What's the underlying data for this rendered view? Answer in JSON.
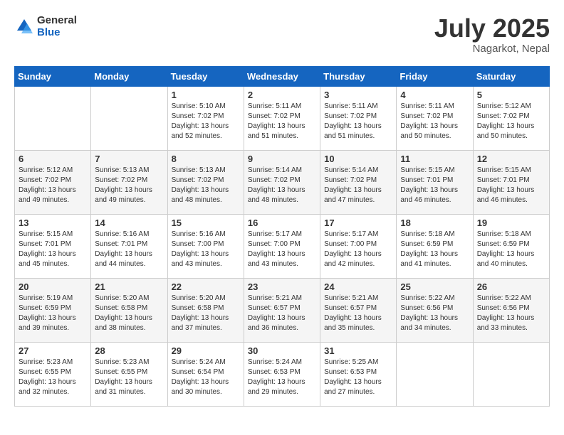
{
  "header": {
    "logo_general": "General",
    "logo_blue": "Blue",
    "month_year": "July 2025",
    "location": "Nagarkot, Nepal"
  },
  "days_of_week": [
    "Sunday",
    "Monday",
    "Tuesday",
    "Wednesday",
    "Thursday",
    "Friday",
    "Saturday"
  ],
  "weeks": [
    [
      {
        "day": "",
        "info": ""
      },
      {
        "day": "",
        "info": ""
      },
      {
        "day": "1",
        "info": "Sunrise: 5:10 AM\nSunset: 7:02 PM\nDaylight: 13 hours and 52 minutes."
      },
      {
        "day": "2",
        "info": "Sunrise: 5:11 AM\nSunset: 7:02 PM\nDaylight: 13 hours and 51 minutes."
      },
      {
        "day": "3",
        "info": "Sunrise: 5:11 AM\nSunset: 7:02 PM\nDaylight: 13 hours and 51 minutes."
      },
      {
        "day": "4",
        "info": "Sunrise: 5:11 AM\nSunset: 7:02 PM\nDaylight: 13 hours and 50 minutes."
      },
      {
        "day": "5",
        "info": "Sunrise: 5:12 AM\nSunset: 7:02 PM\nDaylight: 13 hours and 50 minutes."
      }
    ],
    [
      {
        "day": "6",
        "info": "Sunrise: 5:12 AM\nSunset: 7:02 PM\nDaylight: 13 hours and 49 minutes."
      },
      {
        "day": "7",
        "info": "Sunrise: 5:13 AM\nSunset: 7:02 PM\nDaylight: 13 hours and 49 minutes."
      },
      {
        "day": "8",
        "info": "Sunrise: 5:13 AM\nSunset: 7:02 PM\nDaylight: 13 hours and 48 minutes."
      },
      {
        "day": "9",
        "info": "Sunrise: 5:14 AM\nSunset: 7:02 PM\nDaylight: 13 hours and 48 minutes."
      },
      {
        "day": "10",
        "info": "Sunrise: 5:14 AM\nSunset: 7:02 PM\nDaylight: 13 hours and 47 minutes."
      },
      {
        "day": "11",
        "info": "Sunrise: 5:15 AM\nSunset: 7:01 PM\nDaylight: 13 hours and 46 minutes."
      },
      {
        "day": "12",
        "info": "Sunrise: 5:15 AM\nSunset: 7:01 PM\nDaylight: 13 hours and 46 minutes."
      }
    ],
    [
      {
        "day": "13",
        "info": "Sunrise: 5:15 AM\nSunset: 7:01 PM\nDaylight: 13 hours and 45 minutes."
      },
      {
        "day": "14",
        "info": "Sunrise: 5:16 AM\nSunset: 7:01 PM\nDaylight: 13 hours and 44 minutes."
      },
      {
        "day": "15",
        "info": "Sunrise: 5:16 AM\nSunset: 7:00 PM\nDaylight: 13 hours and 43 minutes."
      },
      {
        "day": "16",
        "info": "Sunrise: 5:17 AM\nSunset: 7:00 PM\nDaylight: 13 hours and 43 minutes."
      },
      {
        "day": "17",
        "info": "Sunrise: 5:17 AM\nSunset: 7:00 PM\nDaylight: 13 hours and 42 minutes."
      },
      {
        "day": "18",
        "info": "Sunrise: 5:18 AM\nSunset: 6:59 PM\nDaylight: 13 hours and 41 minutes."
      },
      {
        "day": "19",
        "info": "Sunrise: 5:18 AM\nSunset: 6:59 PM\nDaylight: 13 hours and 40 minutes."
      }
    ],
    [
      {
        "day": "20",
        "info": "Sunrise: 5:19 AM\nSunset: 6:59 PM\nDaylight: 13 hours and 39 minutes."
      },
      {
        "day": "21",
        "info": "Sunrise: 5:20 AM\nSunset: 6:58 PM\nDaylight: 13 hours and 38 minutes."
      },
      {
        "day": "22",
        "info": "Sunrise: 5:20 AM\nSunset: 6:58 PM\nDaylight: 13 hours and 37 minutes."
      },
      {
        "day": "23",
        "info": "Sunrise: 5:21 AM\nSunset: 6:57 PM\nDaylight: 13 hours and 36 minutes."
      },
      {
        "day": "24",
        "info": "Sunrise: 5:21 AM\nSunset: 6:57 PM\nDaylight: 13 hours and 35 minutes."
      },
      {
        "day": "25",
        "info": "Sunrise: 5:22 AM\nSunset: 6:56 PM\nDaylight: 13 hours and 34 minutes."
      },
      {
        "day": "26",
        "info": "Sunrise: 5:22 AM\nSunset: 6:56 PM\nDaylight: 13 hours and 33 minutes."
      }
    ],
    [
      {
        "day": "27",
        "info": "Sunrise: 5:23 AM\nSunset: 6:55 PM\nDaylight: 13 hours and 32 minutes."
      },
      {
        "day": "28",
        "info": "Sunrise: 5:23 AM\nSunset: 6:55 PM\nDaylight: 13 hours and 31 minutes."
      },
      {
        "day": "29",
        "info": "Sunrise: 5:24 AM\nSunset: 6:54 PM\nDaylight: 13 hours and 30 minutes."
      },
      {
        "day": "30",
        "info": "Sunrise: 5:24 AM\nSunset: 6:53 PM\nDaylight: 13 hours and 29 minutes."
      },
      {
        "day": "31",
        "info": "Sunrise: 5:25 AM\nSunset: 6:53 PM\nDaylight: 13 hours and 27 minutes."
      },
      {
        "day": "",
        "info": ""
      },
      {
        "day": "",
        "info": ""
      }
    ]
  ]
}
